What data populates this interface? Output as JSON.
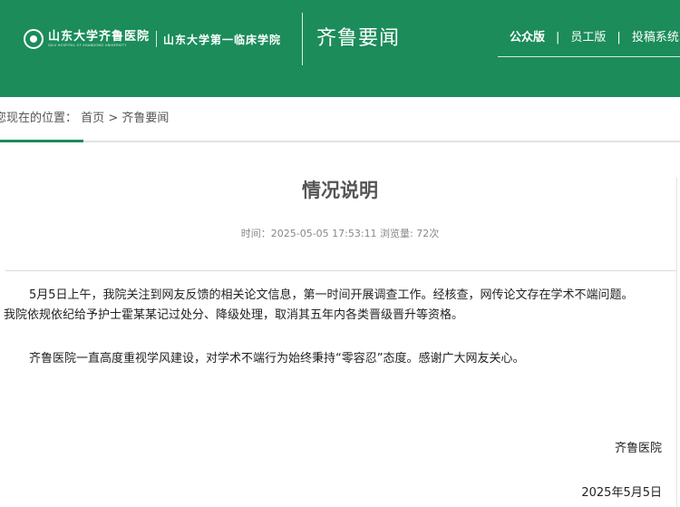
{
  "header": {
    "logo": {
      "cn": "山东大学齐鲁医院",
      "en": "QILU HOSPITAL OF SHANDONG UNIVERSITY",
      "cn2": "山东大学第一临床学院"
    },
    "site_title": "齐鲁要闻",
    "nav": [
      {
        "label": "公众版"
      },
      {
        "label": "员工版"
      },
      {
        "label": "投稿系统"
      }
    ],
    "nav_separator": "|"
  },
  "breadcrumb": {
    "prefix": "您现在的位置：",
    "home": "首页",
    "separator": ">",
    "current": "齐鲁要闻"
  },
  "article": {
    "title": "情况说明",
    "meta": "时间：2025-05-05 17:53:11 浏览量: 72次",
    "paragraph1_line1": "5月5日上午，我院关注到网友反馈的相关论文信息，第一时间开展调查工作。经核查，网传论文存在学术不端问题。",
    "paragraph1_line2": "我院依规依纪给予护士霍某某记过处分、降级处理，取消其五年内各类晋级晋升等资格。",
    "paragraph2": "齐鲁医院一直高度重视学风建设，对学术不端行为始终秉持“零容忍”态度。感谢广大网友关心。",
    "signer": "齐鲁医院",
    "date": "2025年5月5日"
  },
  "colors": {
    "brand_green": "#1b8c5a",
    "title_gray": "#555555",
    "meta_gray": "#888888"
  }
}
